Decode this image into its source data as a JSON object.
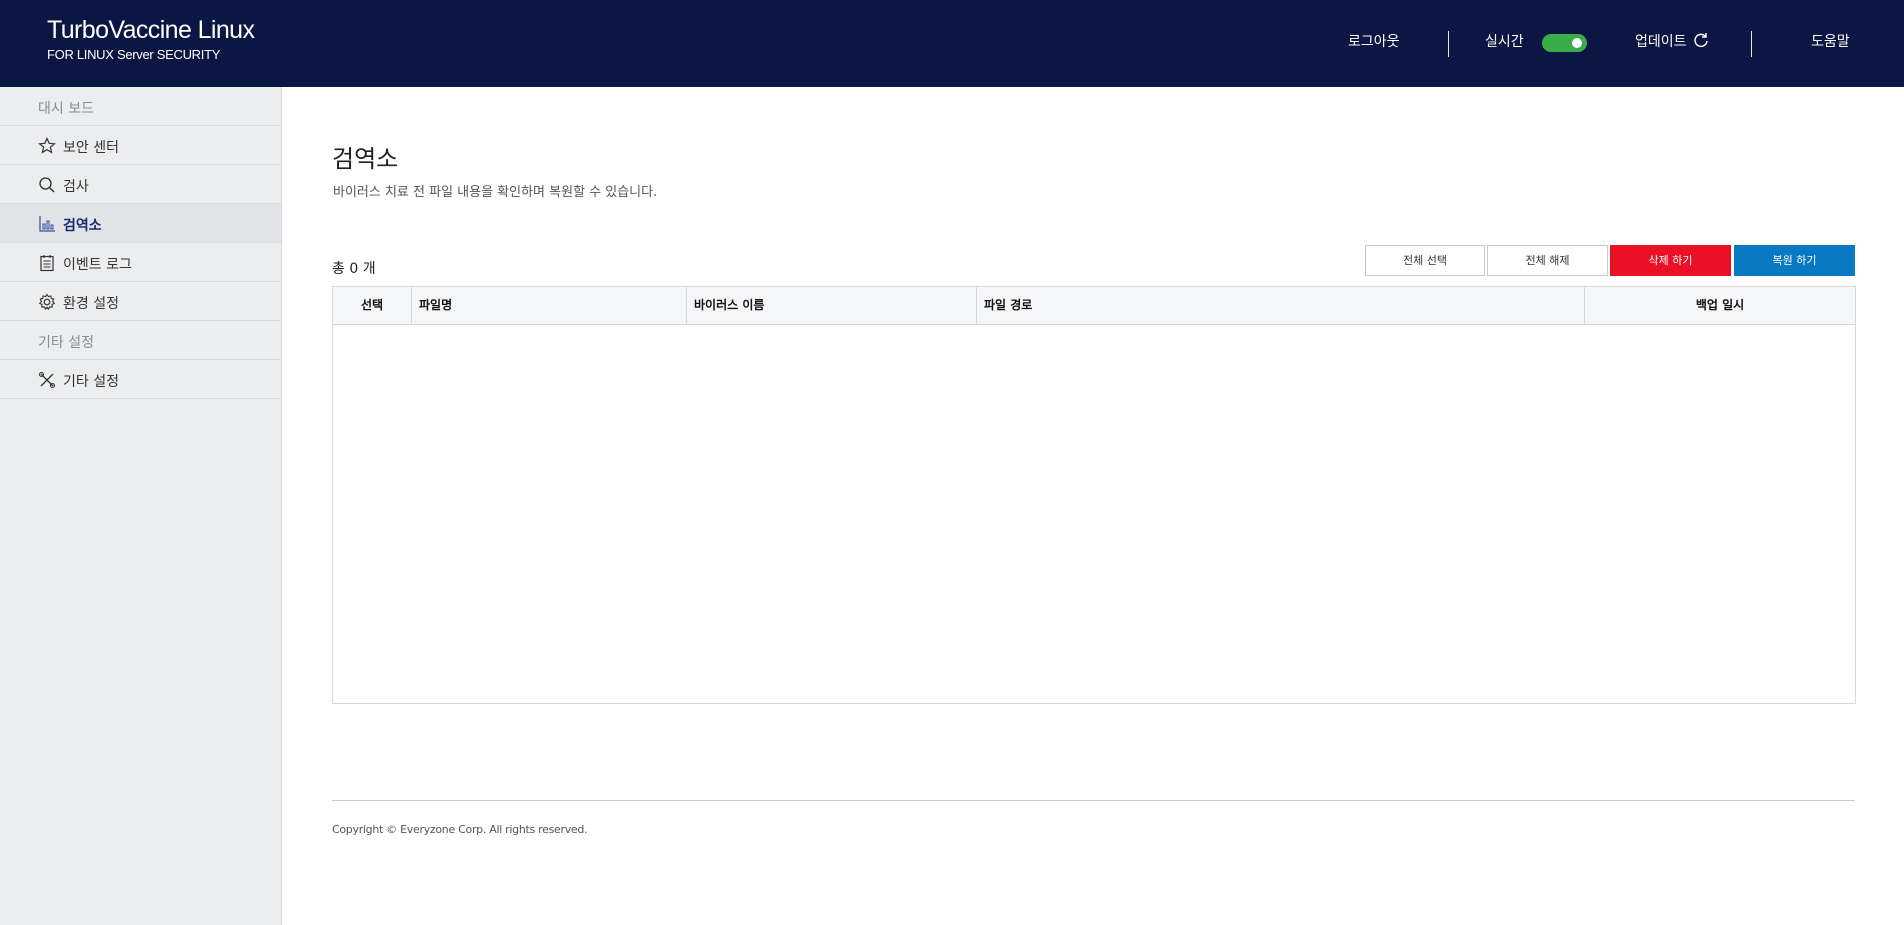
{
  "header": {
    "brand_title": "TurboVaccine Linux",
    "brand_subtitle": "FOR LINUX Server SECURITY",
    "logout": "로그아웃",
    "realtime": "실시간",
    "realtime_on": true,
    "update": "업데이트",
    "help": "도움말"
  },
  "sidebar": {
    "group1": "대시 보드",
    "items1": [
      {
        "label": "보안 센터",
        "icon": "star-icon"
      },
      {
        "label": "검사",
        "icon": "search-icon"
      },
      {
        "label": "검역소",
        "icon": "chart-icon",
        "active": true
      },
      {
        "label": "이벤트 로그",
        "icon": "clipboard-icon"
      },
      {
        "label": "환경 설정",
        "icon": "gear-icon"
      }
    ],
    "group2": "기타 설정",
    "items2": [
      {
        "label": "기타 설정",
        "icon": "tools-icon"
      }
    ]
  },
  "main": {
    "title": "검역소",
    "description": "바이러스 치료 전 파일 내용을 확인하며 복원할 수 있습니다.",
    "total": "총 0 개",
    "buttons": {
      "select_all": "전체 선택",
      "deselect_all": "전체 해제",
      "delete": "삭제 하기",
      "restore": "복원 하기"
    },
    "table": {
      "columns": [
        "선택",
        "파일명",
        "바이러스 이름",
        "파일 경로",
        "백업 일시"
      ],
      "rows": []
    }
  },
  "footer": {
    "copyright": "Copyright © Everyzone Corp. All rights reserved."
  },
  "colors": {
    "header_bg": "#0b1642",
    "toggle_on": "#3aad4a",
    "delete_red": "#ec1026",
    "restore_blue": "#0a79c3"
  }
}
